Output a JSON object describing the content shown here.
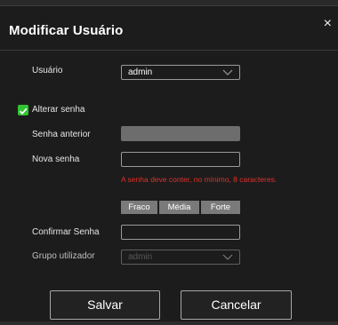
{
  "dialog": {
    "title": "Modificar Usuário",
    "close_symbol": "×"
  },
  "form": {
    "user_label": "Usuário",
    "user_value": "admin",
    "change_password_label": "Alterar senha",
    "change_password_checked": true,
    "old_password_label": "Senha anterior",
    "new_password_label": "Nova senha",
    "password_error": "A senha deve conter, no mínimo, 8 caracteres.",
    "strength": [
      "Fraco",
      "Média",
      "Forte"
    ],
    "confirm_password_label": "Confirmar Senha",
    "group_label": "Grupo utilizador",
    "group_value": "admin"
  },
  "buttons": {
    "save": "Salvar",
    "cancel": "Cancelar"
  },
  "colors": {
    "checkbox": "#31c431",
    "error": "#e0302a",
    "strength_bar": "#7a7a7a"
  }
}
